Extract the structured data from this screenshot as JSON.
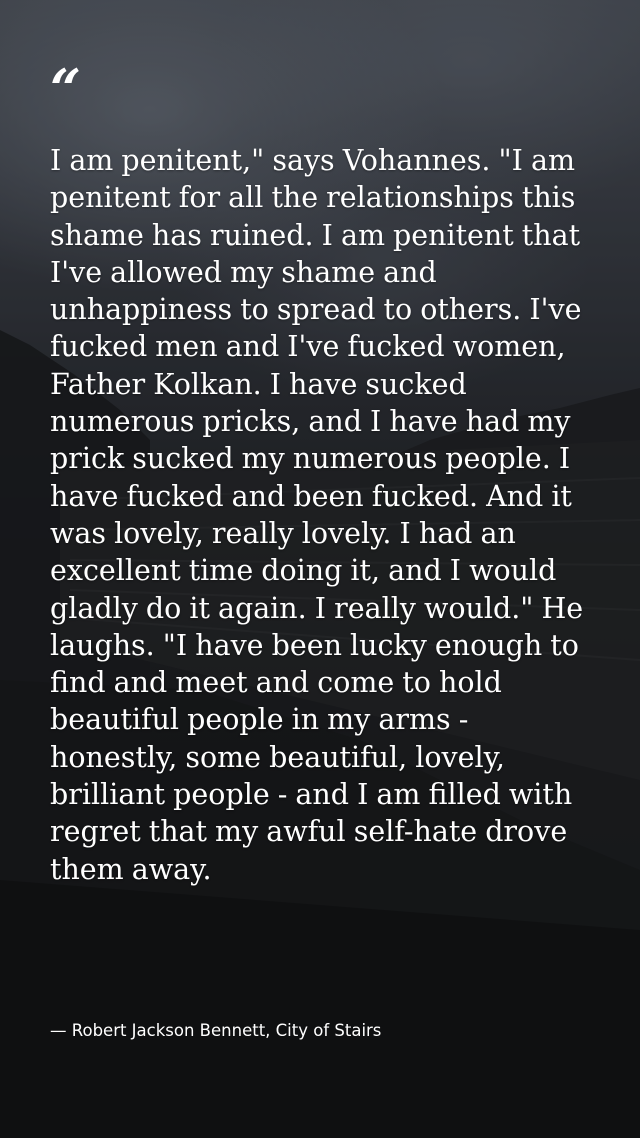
{
  "quote": {
    "mark": "“",
    "text": "I am penitent,\" says Vohannes. \"I am penitent for all the relationships this shame has ruined. I am penitent that I've allowed my shame and unhappiness to spread to others. I've fucked men and I've fucked women, Father Kolkan. I have sucked numerous pricks, and I have had my prick sucked my numerous people. I have fucked and been fucked. And it was lovely, really lovely. I had an excellent time doing it, and I would gladly do it again. I really would.\" He laughs. \"I have been lucky enough to find and meet and come to hold beautiful people in my arms - honestly, some beautiful, lovely, brilliant people - and I am filled with regret that my awful self-hate drove them away.",
    "attribution": "— Robert Jackson Bennett, City of Stairs"
  },
  "colors": {
    "text": "#ffffff",
    "background_top": "#4b5059",
    "background_bottom": "#141516"
  }
}
